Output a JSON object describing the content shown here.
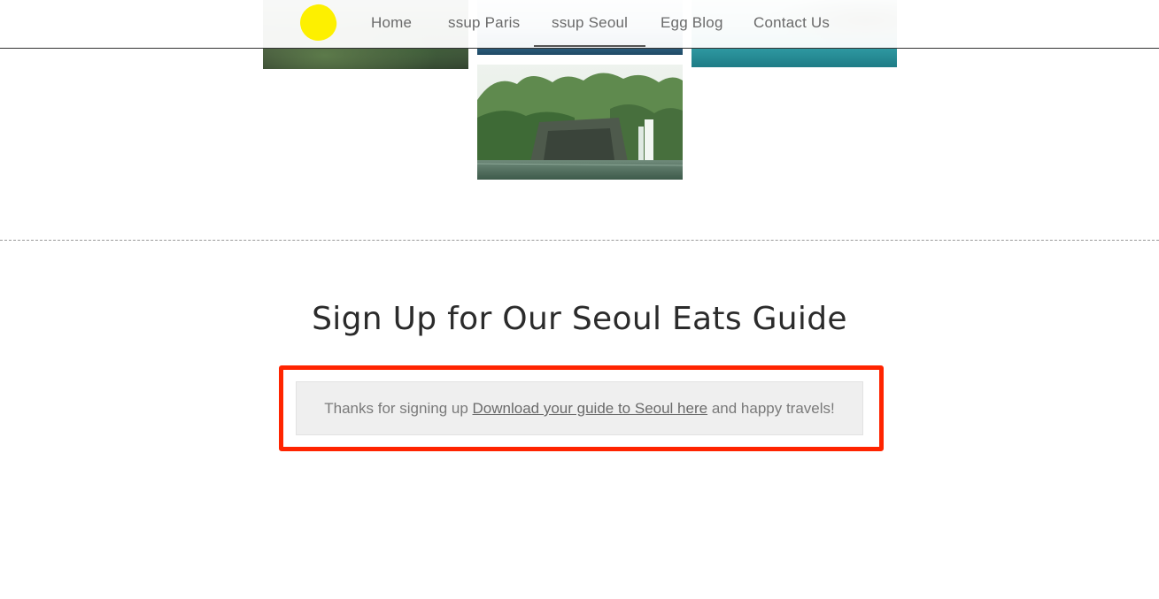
{
  "nav": {
    "items": [
      {
        "label": "Home",
        "active": false
      },
      {
        "label": "ssup Paris",
        "active": false
      },
      {
        "label": "ssup Seoul",
        "active": true
      },
      {
        "label": "Egg Blog",
        "active": false
      },
      {
        "label": "Contact Us",
        "active": false
      }
    ]
  },
  "colors": {
    "logo": "#fdf000",
    "highlight_border": "#ff2400",
    "message_bg": "#efefef"
  },
  "signup": {
    "title": "Sign Up for Our Seoul Eats Guide",
    "message_prefix": "Thanks for signing up ",
    "message_link": "Download your guide to Seoul here",
    "message_suffix": " and happy travels!"
  }
}
